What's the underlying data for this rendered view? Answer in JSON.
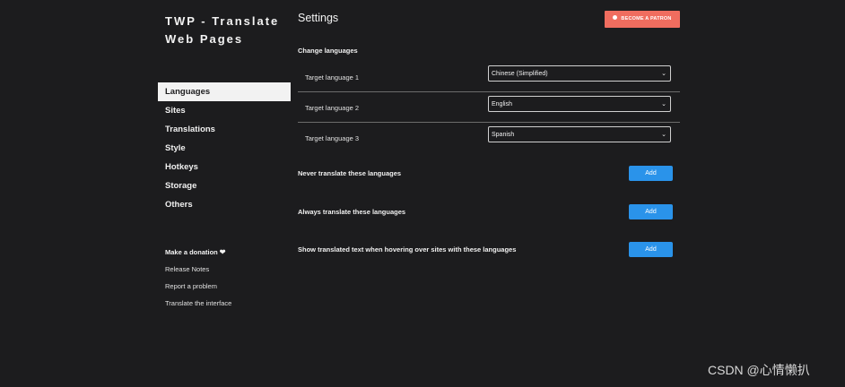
{
  "app_title": "TWP - Translate Web Pages",
  "nav": {
    "items": [
      {
        "label": "Languages",
        "active": true
      },
      {
        "label": "Sites"
      },
      {
        "label": "Translations"
      },
      {
        "label": "Style"
      },
      {
        "label": "Hotkeys"
      },
      {
        "label": "Storage"
      },
      {
        "label": "Others"
      }
    ]
  },
  "links": {
    "donation": "Make a donation",
    "release_notes": "Release Notes",
    "report": "Report a problem",
    "translate_interface": "Translate the interface"
  },
  "settings": {
    "title": "Settings",
    "patron_label": "BECOME A PATRON",
    "change_languages": "Change languages",
    "target_languages": [
      {
        "label": "Target language 1",
        "value": "Chinese (Simplified)"
      },
      {
        "label": "Target language 2",
        "value": "English"
      },
      {
        "label": "Target language 3",
        "value": "Spanish"
      }
    ],
    "never_translate": "Never translate these languages",
    "always_translate": "Always translate these languages",
    "show_hover": "Show translated text when hovering over sites with these languages",
    "add_label": "Add"
  },
  "watermark": "CSDN @心情懒扒",
  "colors": {
    "background": "#1c1c1e",
    "patron": "#f06d5f",
    "add_button": "#2a93ea"
  }
}
